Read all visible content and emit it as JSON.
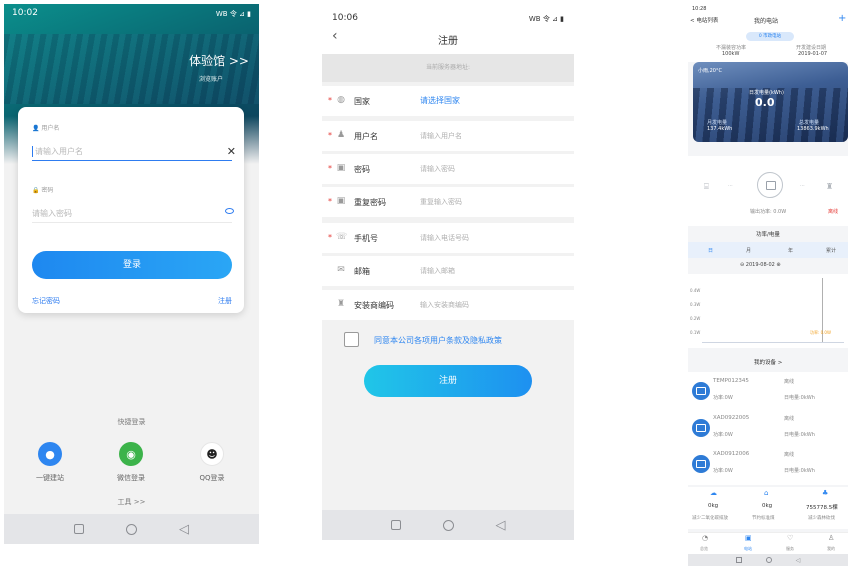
{
  "login": {
    "status_time": "10:02",
    "status_right": "WB 令 ⊿ ▮",
    "experience_label": "体验馆 >>",
    "experience_sub": "浏览账户",
    "username_label": "用户名",
    "username_placeholder": "请输入用户名",
    "password_label": "密码",
    "password_placeholder": "请输入密码",
    "login_button": "登录",
    "forgot_password": "忘记密码",
    "register_link": "注册",
    "quick_login_title": "快捷登录",
    "quick_options": [
      {
        "label": "一键建站",
        "color": "#2e86f0",
        "icon": "user-icon"
      },
      {
        "label": "微信登录",
        "color": "#3cb34a",
        "icon": "wechat-icon"
      },
      {
        "label": "QQ登录",
        "color": "#f2f2f2",
        "icon": "qq-icon"
      }
    ],
    "tools_link": "工具 >>"
  },
  "register": {
    "status_time": "10:06",
    "status_right": "WB 令 ⊿ ▮",
    "title": "注册",
    "server_hint": "当前服务器地址:",
    "rows": [
      {
        "required": true,
        "icon": "globe-icon",
        "label": "国家",
        "value": "请选择国家",
        "is_link": true
      },
      {
        "required": true,
        "icon": "user-icon",
        "label": "用户名",
        "value": "请输入用户名",
        "is_link": false
      },
      {
        "required": true,
        "icon": "lock-icon",
        "label": "密码",
        "value": "请输入密码",
        "is_link": false
      },
      {
        "required": true,
        "icon": "lock-icon",
        "label": "重复密码",
        "value": "重复输入密码",
        "is_link": false
      },
      {
        "required": true,
        "icon": "phone-icon",
        "label": "手机号",
        "value": "请输入电话号码",
        "is_link": false
      },
      {
        "required": false,
        "icon": "mail-icon",
        "label": "邮箱",
        "value": "请输入邮箱",
        "is_link": false
      },
      {
        "required": false,
        "icon": "installer-icon",
        "label": "安装商编码",
        "value": "输入安装商编码",
        "is_link": false
      }
    ],
    "agreement": "同意本公司各项用户条款及隐私政策",
    "register_button": "注册"
  },
  "plant": {
    "status_time": "10:28",
    "back_label": "< 电站列表",
    "title": "我的电站",
    "add_icon": "+",
    "pill": "0 市政电站",
    "capacity_label": "不漏装容功率",
    "capacity_value": "100kW",
    "install_label": "开发建设日期",
    "install_value": "2019-01-07",
    "weather": "小雨,20°C",
    "today_label": "日发电量(kWh)",
    "today_value": "0.0",
    "month_label": "月发电量",
    "month_value": "137.4kWh",
    "total_label": "总发电量",
    "total_value": "13863.9kWh",
    "output_label": "输出功率: 0.0W",
    "status_badge": "离线",
    "power_title": "功率/电量",
    "tabs": [
      "日",
      "月",
      "年",
      "累计"
    ],
    "date": "2019-08-02",
    "y_ticks": [
      "0.0W",
      "0.4W",
      "0.3W",
      "0.2W",
      "0.1W",
      "0.0W"
    ],
    "tooltip": "功率: 0.0W",
    "devices_title": "我的设备 >",
    "devices": [
      {
        "sn": "TEMP012345",
        "status": "离线",
        "power": "功率:0W",
        "energy": "日电量:0kWh"
      },
      {
        "sn": "XAD0922005",
        "status": "离线",
        "power": "功率:0W",
        "energy": "日电量:0kWh"
      },
      {
        "sn": "XAD0912006",
        "status": "离线",
        "power": "功率:0W",
        "energy": "日电量:0kWh"
      }
    ],
    "stats": [
      {
        "value": "0kg",
        "label": "减少二氧化碳排放"
      },
      {
        "value": "0kg",
        "label": "节约标准煤"
      },
      {
        "value": "755778.5棵",
        "label": "减少森林砍伐"
      }
    ],
    "bottom_nav": [
      "总览",
      "电站",
      "服务",
      "我的"
    ]
  }
}
